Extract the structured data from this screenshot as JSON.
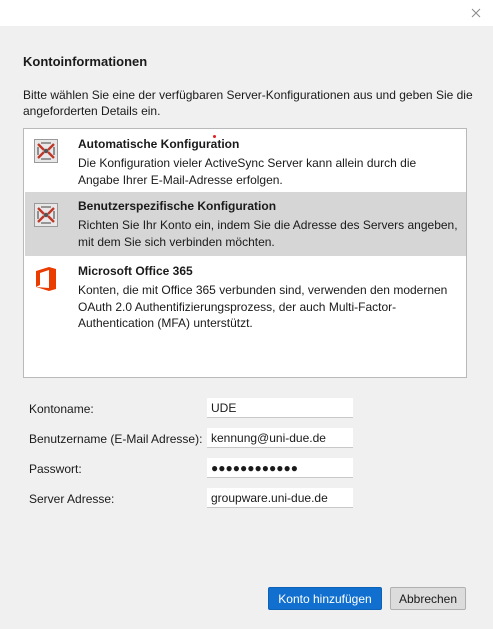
{
  "dialog": {
    "close_icon": "close-icon",
    "heading": "Kontoinformationen",
    "intro": "Bitte wählen Sie eine der verfügbaren Server-Konfigurationen aus und geben Sie die angeforderten Details ein."
  },
  "options": [
    {
      "title": "Automatische Konfiguration",
      "description": "Die Konfiguration vieler ActiveSync Server kann allein durch die Angabe Ihrer E-Mail-Adresse erfolgen.",
      "icon": "activesync-icon",
      "selected": false
    },
    {
      "title": "Benutzerspezifische Konfiguration",
      "description": "Richten Sie Ihr Konto ein, indem Sie die Adresse des Servers angeben, mit dem Sie sich verbinden möchten.",
      "icon": "activesync-icon",
      "selected": true
    },
    {
      "title": "Microsoft Office 365",
      "description": "Konten, die mit Office 365 verbunden sind, verwenden den modernen OAuth 2.0 Authentifizierungsprozess, der auch Multi-Factor-Authentication (MFA) unterstützt.",
      "icon": "office-365-icon",
      "selected": false
    }
  ],
  "form": {
    "account_name_label": "Kontoname:",
    "account_name_value": "UDE",
    "username_label": "Benutzername (E-Mail Adresse):",
    "username_value": "kennung@uni-due.de",
    "password_label": "Passwort:",
    "password_value": "●●●●●●●●●●●●",
    "server_label": "Server Adresse:",
    "server_value": "groupware.uni-due.de"
  },
  "buttons": {
    "add_account": "Konto hinzufügen",
    "cancel": "Abbrechen"
  },
  "colors": {
    "primary_button": "#1170cf",
    "selected_row": "#d6d6d6",
    "office_orange": "#eb3c00",
    "panel_bg": "#f0f0f0"
  }
}
